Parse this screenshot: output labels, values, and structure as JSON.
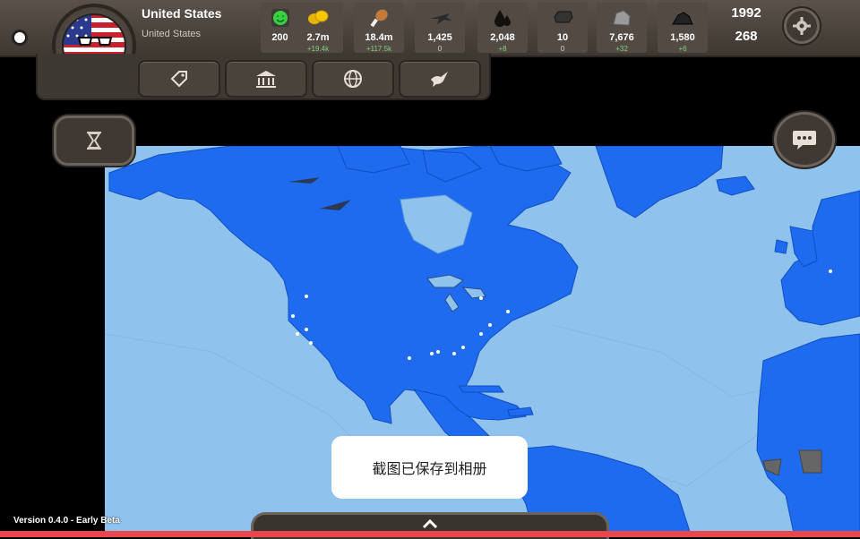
{
  "country": {
    "name": "United States",
    "subtitle": "United States"
  },
  "resources": [
    {
      "icon": "happiness-face-icon",
      "value": "200",
      "change": ""
    },
    {
      "icon": "gold-coins-icon",
      "value": "2.7m",
      "change": "+19.4k"
    },
    {
      "icon": "food-drumstick-icon",
      "value": "18.4m",
      "change": "+117.5k"
    },
    {
      "icon": "military-plane-icon",
      "value": "1,425",
      "change": "0"
    },
    {
      "icon": "oil-drops-icon",
      "value": "2,048",
      "change": "+8"
    },
    {
      "icon": "steel-ingot-icon",
      "value": "10",
      "change": "0"
    },
    {
      "icon": "stone-rocks-icon",
      "value": "7,676",
      "change": "+32"
    },
    {
      "icon": "coal-pile-icon",
      "value": "1,580",
      "change": "+6"
    }
  ],
  "date": {
    "year": "1992",
    "day": "268"
  },
  "toolbar_icons": [
    "trade-tag-icon",
    "government-building-icon",
    "globe-diplomacy-icon",
    "peace-dove-icon"
  ],
  "toast": "截图已保存到相册",
  "version": "Version 0.4.0 - Early Beta",
  "colors": {
    "player_territory": "#1e6bef",
    "ocean": "#8fc3ee",
    "panel": "#3e3832",
    "accent_green": "#7fd37f"
  }
}
